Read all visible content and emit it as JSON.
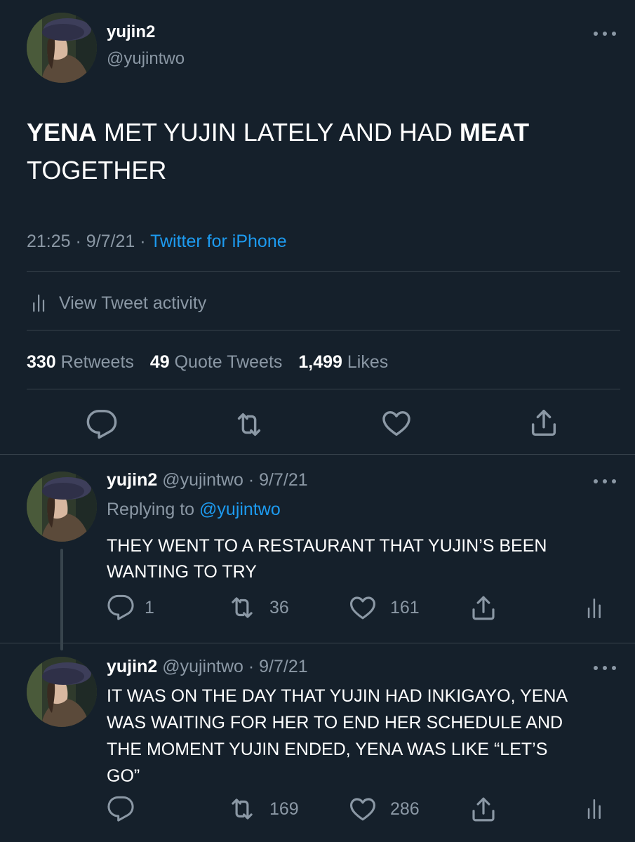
{
  "main_tweet": {
    "display_name": "yujin2",
    "handle": "@yujintwo",
    "text_bold_1": "YENA",
    "text_1": " MET YUJIN LATELY AND HAD ",
    "text_bold_2": "MEAT",
    "text_2": "TOGETHER",
    "time": "21:25",
    "date": "9/7/21",
    "sep": "·",
    "source": "Twitter for iPhone",
    "activity_label": "View Tweet activity",
    "retweets_count": "330",
    "retweets_label": "Retweets",
    "quotes_count": "49",
    "quotes_label": "Quote Tweets",
    "likes_count": "1,499",
    "likes_label": "Likes"
  },
  "replies": [
    {
      "display_name": "yujin2",
      "meta": "@yujintwo · 9/7/21",
      "replying_prefix": "Replying to",
      "replying_handle": "@yujintwo",
      "text_line1": "THEY WENT TO A RESTAURANT THAT YUJIN’S BEEN",
      "text_line2": "WANTING TO TRY",
      "reply_count": "1",
      "retweet_count": "36",
      "like_count": "161"
    },
    {
      "display_name": "yujin2",
      "meta": "@yujintwo · 9/7/21",
      "text_line1": "IT WAS ON THE DAY THAT YUJIN HAD INKIGAYO, YENA",
      "text_line2": "WAS WAITING FOR HER TO END HER SCHEDULE AND",
      "text_line3": "THE MOMENT YUJIN ENDED, YENA WAS LIKE “LET’S",
      "text_line4": "GO”",
      "retweet_count": "169",
      "like_count": "286"
    }
  ],
  "colors": {
    "background": "#15202b",
    "muted": "#8b98a5",
    "link": "#1d9bf0",
    "divider": "#38444d"
  },
  "icons": [
    "more-icon",
    "activity-icon",
    "reply-icon",
    "retweet-icon",
    "like-icon",
    "share-icon"
  ]
}
